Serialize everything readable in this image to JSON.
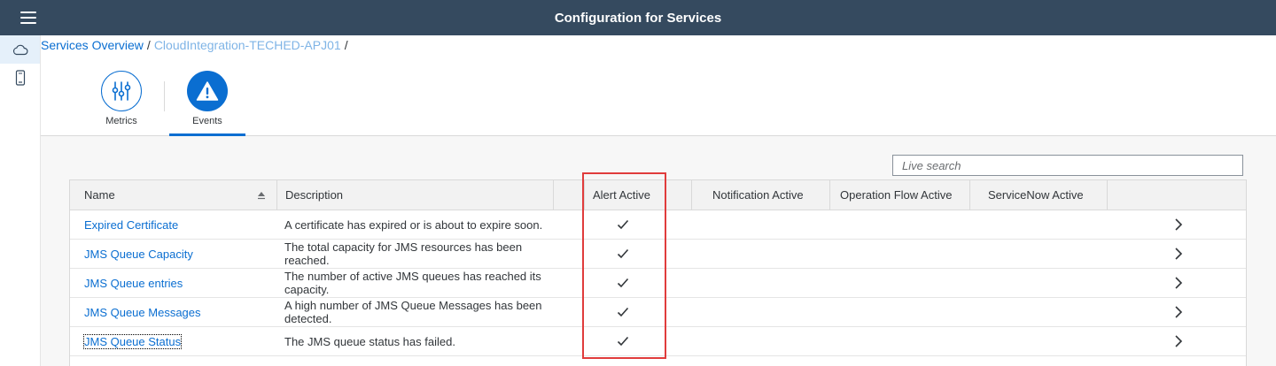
{
  "shell": {
    "title": "Configuration for Services",
    "menu_icon": "hamburger-menu-icon"
  },
  "side_nav": {
    "items": [
      {
        "icon": "cloud-icon",
        "active": true
      },
      {
        "icon": "mobile-device-icon",
        "active": false
      }
    ]
  },
  "breadcrumb": {
    "items": [
      "Services Overview",
      "CloudIntegration-TECHED-APJ01"
    ],
    "separator": "/"
  },
  "tabs": [
    {
      "label": "Metrics",
      "icon": "sliders-icon",
      "selected": false
    },
    {
      "label": "Events",
      "icon": "warning-icon",
      "selected": true
    }
  ],
  "search": {
    "placeholder": "Live search",
    "value": ""
  },
  "table": {
    "columns": [
      "Name",
      "Description",
      "",
      "Alert Active",
      "Notification Active",
      "Operation Flow Active",
      "ServiceNow Active",
      ""
    ],
    "rows": [
      {
        "name": "Expired Certificate",
        "description": "A certificate has expired or is about to expire soon.",
        "alert_active": true
      },
      {
        "name": "JMS Queue Capacity",
        "description": "The total capacity for JMS resources has been reached.",
        "alert_active": true
      },
      {
        "name": "JMS Queue entries",
        "description": "The number of active JMS queues has reached its capacity.",
        "alert_active": true
      },
      {
        "name": "JMS Queue Messages",
        "description": "A high number of JMS Queue Messages has been detected.",
        "alert_active": true
      },
      {
        "name": "JMS Queue Status",
        "description": "The JMS queue status has failed.",
        "alert_active": true
      }
    ]
  },
  "colors": {
    "shell": "#354a5f",
    "accent": "#0a6ed1",
    "highlight": "#e03c3c"
  }
}
